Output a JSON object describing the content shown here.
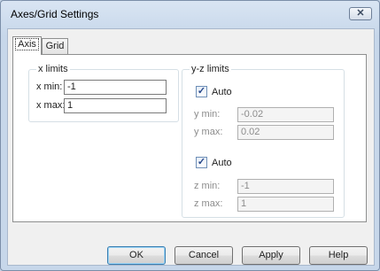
{
  "window": {
    "title": "Axes/Grid Settings",
    "close_symbol": "✕"
  },
  "tabs": [
    {
      "label": "Axis",
      "selected": true
    },
    {
      "label": "Grid",
      "selected": false
    }
  ],
  "x_limits": {
    "title": "x limits",
    "x_min_label": "x min:",
    "x_min_value": "-1",
    "x_max_label": "x max:",
    "x_max_value": "1"
  },
  "yz_limits": {
    "title": "y-z limits",
    "y_auto_label": "Auto",
    "y_auto_checked": true,
    "y_min_label": "y min:",
    "y_min_value": "-0.02",
    "y_max_label": "y max:",
    "y_max_value": "0.02",
    "z_auto_label": "Auto",
    "z_auto_checked": true,
    "z_min_label": "z min:",
    "z_min_value": "-1",
    "z_max_label": "z max:",
    "z_max_value": "1"
  },
  "buttons": {
    "ok": "OK",
    "cancel": "Cancel",
    "apply": "Apply",
    "help": "Help"
  },
  "check_glyph": "✓"
}
